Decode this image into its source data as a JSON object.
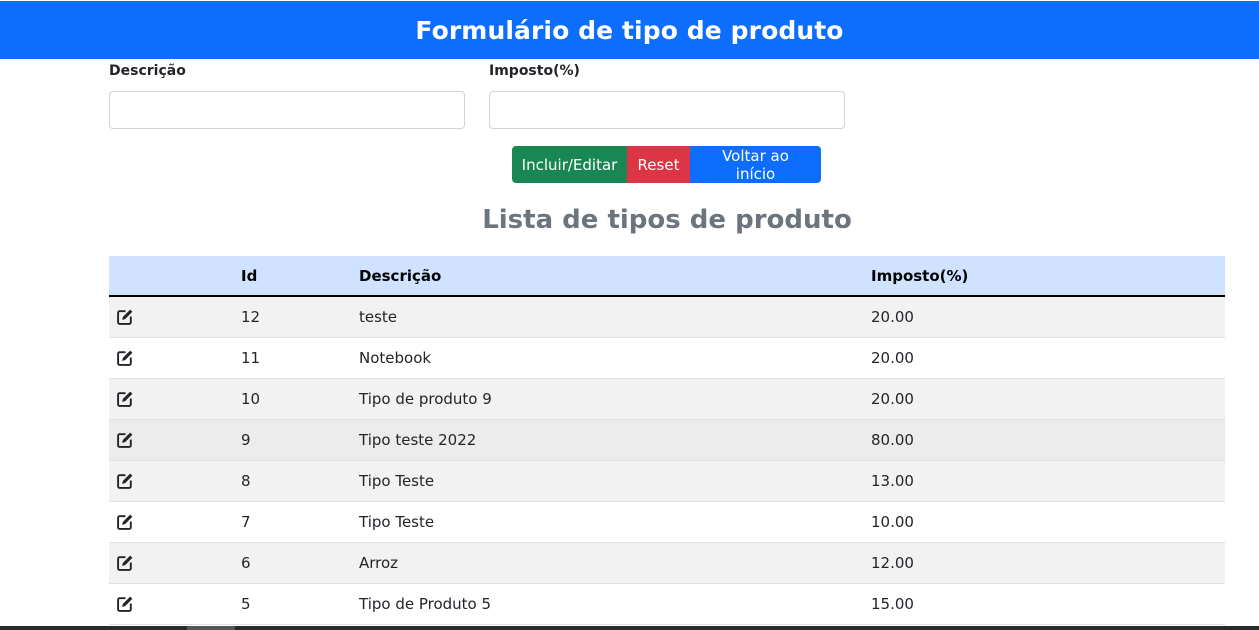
{
  "header": {
    "title": "Formulário de tipo de produto"
  },
  "form": {
    "descricao_label": "Descrição",
    "descricao_value": "",
    "imposto_label": "Imposto(%)",
    "imposto_value": ""
  },
  "buttons": {
    "include_edit": "Incluir/Editar",
    "reset": "Reset",
    "back": "Voltar ao início"
  },
  "list": {
    "title": "Lista de tipos de produto",
    "columns": {
      "actions": "",
      "id": "Id",
      "descricao": "Descrição",
      "imposto": "Imposto(%)"
    },
    "rows": [
      {
        "id": "12",
        "descricao": "teste",
        "imposto": "20.00"
      },
      {
        "id": "11",
        "descricao": "Notebook",
        "imposto": "20.00"
      },
      {
        "id": "10",
        "descricao": "Tipo de produto 9",
        "imposto": "20.00"
      },
      {
        "id": "9",
        "descricao": "Tipo teste 2022",
        "imposto": "80.00"
      },
      {
        "id": "8",
        "descricao": "Tipo Teste",
        "imposto": "13.00"
      },
      {
        "id": "7",
        "descricao": "Tipo Teste",
        "imposto": "10.00"
      },
      {
        "id": "6",
        "descricao": "Arroz",
        "imposto": "12.00"
      },
      {
        "id": "5",
        "descricao": "Tipo de Produto 5",
        "imposto": "15.00"
      }
    ],
    "row_icon": "edit-icon"
  },
  "colors": {
    "header_bg": "#0d6efd",
    "success": "#198754",
    "danger": "#dc3545",
    "primary": "#0d6efd",
    "table_head_bg": "#cfe2ff",
    "title_gray": "#6c757d"
  }
}
